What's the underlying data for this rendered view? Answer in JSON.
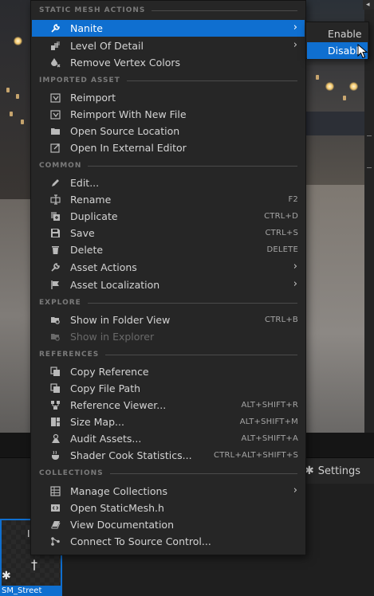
{
  "settings": {
    "label": "Settings",
    "icon": "gear-icon"
  },
  "asset": {
    "name": "SM_Street"
  },
  "context_menu": {
    "sections": [
      {
        "header": "STATIC MESH ACTIONS",
        "items": [
          {
            "label": "Nanite",
            "icon": "wrench-icon",
            "shortcut": "",
            "submenu": true,
            "highlight": true
          },
          {
            "label": "Level Of Detail",
            "icon": "lod-icon",
            "shortcut": "",
            "submenu": true
          },
          {
            "label": "Remove Vertex Colors",
            "icon": "paint-drop-icon",
            "shortcut": ""
          }
        ]
      },
      {
        "header": "IMPORTED ASSET",
        "items": [
          {
            "label": "Reimport",
            "icon": "reimport-icon",
            "shortcut": ""
          },
          {
            "label": "Reimport With New File",
            "icon": "reimport-file-icon",
            "shortcut": ""
          },
          {
            "label": "Open Source Location",
            "icon": "folder-open-icon",
            "shortcut": ""
          },
          {
            "label": "Open In External Editor",
            "icon": "external-editor-icon",
            "shortcut": ""
          }
        ]
      },
      {
        "header": "COMMON",
        "items": [
          {
            "label": "Edit...",
            "icon": "pencil-icon",
            "shortcut": ""
          },
          {
            "label": "Rename",
            "icon": "rename-icon",
            "shortcut": "F2"
          },
          {
            "label": "Duplicate",
            "icon": "duplicate-icon",
            "shortcut": "CTRL+D"
          },
          {
            "label": "Save",
            "icon": "save-icon",
            "shortcut": "CTRL+S"
          },
          {
            "label": "Delete",
            "icon": "trash-icon",
            "shortcut": "DELETE"
          },
          {
            "label": "Asset Actions",
            "icon": "wrench-icon",
            "shortcut": "",
            "submenu": true
          },
          {
            "label": "Asset Localization",
            "icon": "flag-icon",
            "shortcut": "",
            "submenu": true
          }
        ]
      },
      {
        "header": "EXPLORE",
        "items": [
          {
            "label": "Show in Folder View",
            "icon": "folder-search-icon",
            "shortcut": "CTRL+B"
          },
          {
            "label": "Show in Explorer",
            "icon": "folder-search-icon",
            "shortcut": "",
            "disabled": true
          }
        ]
      },
      {
        "header": "REFERENCES",
        "items": [
          {
            "label": "Copy Reference",
            "icon": "copy-icon",
            "shortcut": ""
          },
          {
            "label": "Copy File Path",
            "icon": "copy-icon",
            "shortcut": ""
          },
          {
            "label": "Reference Viewer...",
            "icon": "reference-viewer-icon",
            "shortcut": "ALT+SHIFT+R"
          },
          {
            "label": "Size Map...",
            "icon": "size-map-icon",
            "shortcut": "ALT+SHIFT+M"
          },
          {
            "label": "Audit Assets...",
            "icon": "audit-icon",
            "shortcut": "ALT+SHIFT+A"
          },
          {
            "label": "Shader Cook Statistics...",
            "icon": "shader-icon",
            "shortcut": "CTRL+ALT+SHIFT+S"
          }
        ]
      },
      {
        "header": "COLLECTIONS",
        "items": [
          {
            "label": "Manage Collections",
            "icon": "collections-icon",
            "shortcut": "",
            "submenu": true
          },
          {
            "label": "Open StaticMesh.h",
            "icon": "code-file-icon",
            "shortcut": ""
          },
          {
            "label": "View Documentation",
            "icon": "book-icon",
            "shortcut": ""
          },
          {
            "label": "Connect To Source Control...",
            "icon": "source-control-icon",
            "shortcut": ""
          }
        ]
      }
    ]
  },
  "submenu": {
    "items": [
      {
        "label": "Enable"
      },
      {
        "label": "Disable",
        "highlight": true
      }
    ]
  },
  "colors": {
    "accent": "#0f6fd0",
    "menu_bg": "#262626",
    "header_text": "#7a7a7a"
  }
}
